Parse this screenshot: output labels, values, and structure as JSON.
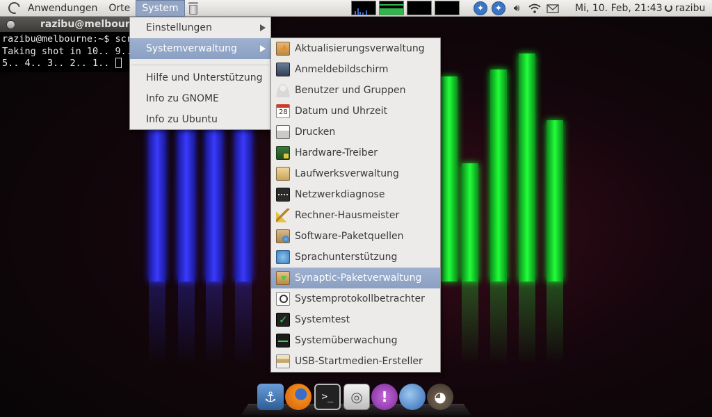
{
  "top_panel": {
    "menus": [
      "Anwendungen",
      "Orte",
      "System"
    ],
    "active_menu": "System",
    "clock": "Mi, 10. Feb, 21:43",
    "user": "razibu",
    "tray_icons": [
      "cpu-monitor-icon",
      "memory-monitor-icon",
      "network-monitor-icon",
      "load-monitor-icon",
      "accessibility-icon",
      "accessibility-icon",
      "volume-icon",
      "wifi-icon",
      "mail-icon",
      "power-icon"
    ]
  },
  "terminal": {
    "title": "razibu@melbourne: ~",
    "lines": [
      "razibu@melbourne:~$ scr",
      "Taking shot in 10.. 9..",
      "5.. 4.. 3.. 2.. 1.. "
    ]
  },
  "system_menu": {
    "items": [
      "Einstellungen",
      "Systemverwaltung",
      "Hilfe und Unterstützung",
      "Info zu GNOME",
      "Info zu Ubuntu"
    ],
    "highlighted": "Systemverwaltung"
  },
  "admin_menu": {
    "items": [
      {
        "label": "Aktualisierungsverwaltung",
        "icon": "update-manager-icon"
      },
      {
        "label": "Anmeldebildschirm",
        "icon": "login-screen-icon"
      },
      {
        "label": "Benutzer und Gruppen",
        "icon": "users-groups-icon"
      },
      {
        "label": "Datum und Uhrzeit",
        "icon": "calendar-icon"
      },
      {
        "label": "Drucken",
        "icon": "printer-icon"
      },
      {
        "label": "Hardware-Treiber",
        "icon": "hardware-driver-icon"
      },
      {
        "label": "Laufwerksverwaltung",
        "icon": "disk-drive-icon"
      },
      {
        "label": "Netzwerkdiagnose",
        "icon": "network-diagnostic-icon"
      },
      {
        "label": "Rechner-Hausmeister",
        "icon": "broom-icon"
      },
      {
        "label": "Software-Paketquellen",
        "icon": "software-sources-icon"
      },
      {
        "label": "Sprachunterstützung",
        "icon": "language-icon"
      },
      {
        "label": "Synaptic-Paketverwaltung",
        "icon": "synaptic-package-icon"
      },
      {
        "label": "Systemprotokollbetrachter",
        "icon": "log-viewer-icon"
      },
      {
        "label": "Systemtest",
        "icon": "system-test-icon"
      },
      {
        "label": "Systemüberwachung",
        "icon": "system-monitor-icon"
      },
      {
        "label": "USB-Startmedien-Ersteller",
        "icon": "usb-creator-icon"
      }
    ],
    "highlighted": "Synaptic-Paketverwaltung"
  },
  "dock": {
    "apps": [
      "anchor-icon",
      "firefox-icon",
      "terminal-icon",
      "disk-icon",
      "notification-icon",
      "thunderbird-icon",
      "gimp-icon"
    ]
  },
  "colors": {
    "menu_highlight": "#8a9fc2",
    "menu_background": "#ecebe9",
    "panel_background": "#d8d6d2",
    "wallpaper_blue_bars": "#3a3aff",
    "wallpaper_green_bars": "#22ff3a"
  }
}
